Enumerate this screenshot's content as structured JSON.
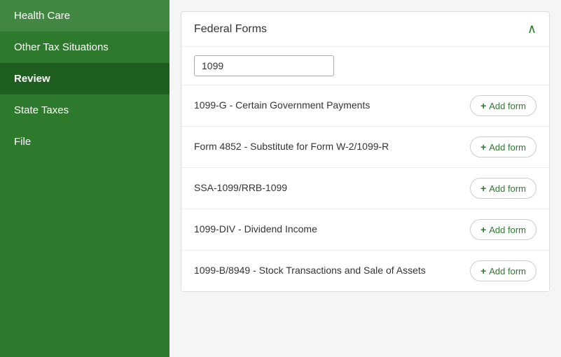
{
  "sidebar": {
    "items": [
      {
        "label": "Health Care",
        "active": false
      },
      {
        "label": "Other Tax Situations",
        "active": false
      },
      {
        "label": "Review",
        "active": true
      },
      {
        "label": "State Taxes",
        "active": false
      },
      {
        "label": "File",
        "active": false
      }
    ]
  },
  "main": {
    "section_title": "Federal Forms",
    "search_placeholder": "",
    "search_value": "1099",
    "forms": [
      {
        "name": "1099-G - Certain Government Payments",
        "add_label": "+ Add form"
      },
      {
        "name": "Form 4852 - Substitute for Form W-2/1099-R",
        "add_label": "+ Add form"
      },
      {
        "name": "SSA-1099/RRB-1099",
        "add_label": "+ Add form"
      },
      {
        "name": "1099-DIV - Dividend Income",
        "add_label": "+ Add form"
      },
      {
        "name": "1099-B/8949 - Stock Transactions and Sale of Assets",
        "add_label": "+ Add form"
      }
    ],
    "chevron": "∧",
    "plus": "+"
  }
}
